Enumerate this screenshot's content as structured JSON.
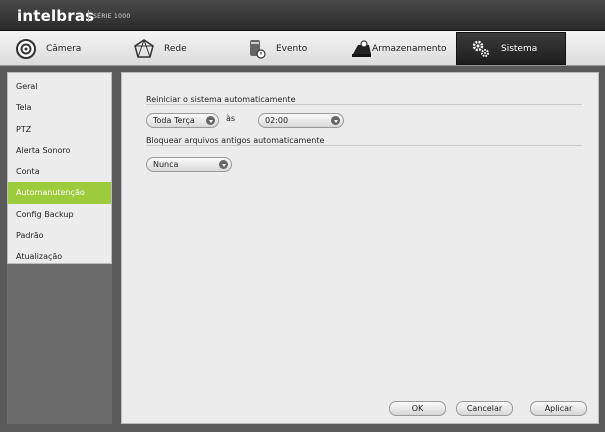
{
  "brand": {
    "logo": "intelbras",
    "series": "SÉRIE 1000"
  },
  "tabs": [
    {
      "label": "Câmera",
      "icon": "camera-icon"
    },
    {
      "label": "Rede",
      "icon": "network-icon"
    },
    {
      "label": "Evento",
      "icon": "event-icon"
    },
    {
      "label": "Armazenamento",
      "icon": "storage-icon"
    },
    {
      "label": "Sistema",
      "icon": "gear-icon",
      "active": true
    }
  ],
  "sidebar": {
    "items": [
      {
        "label": "Geral"
      },
      {
        "label": "Tela"
      },
      {
        "label": "PTZ"
      },
      {
        "label": "Alerta Sonoro"
      },
      {
        "label": "Conta"
      },
      {
        "label": "Automanutenção",
        "active": true
      },
      {
        "label": "Config Backup"
      },
      {
        "label": "Padrão"
      },
      {
        "label": "Atualização"
      }
    ]
  },
  "main": {
    "restart_title": "Reiniciar o sistema automaticamente",
    "restart_day": "Toda Terça",
    "as_label": "às",
    "restart_time": "02:00",
    "delete_title": "Bloquear arquivos antigos automaticamente",
    "delete_value": "Nunca"
  },
  "buttons": {
    "ok": "OK",
    "cancel": "Cancelar",
    "apply": "Aplicar"
  },
  "colors": {
    "active_side": "#9ccc3b",
    "active_tab": "#1e1e1e",
    "topbar": "#2a2a2a"
  }
}
